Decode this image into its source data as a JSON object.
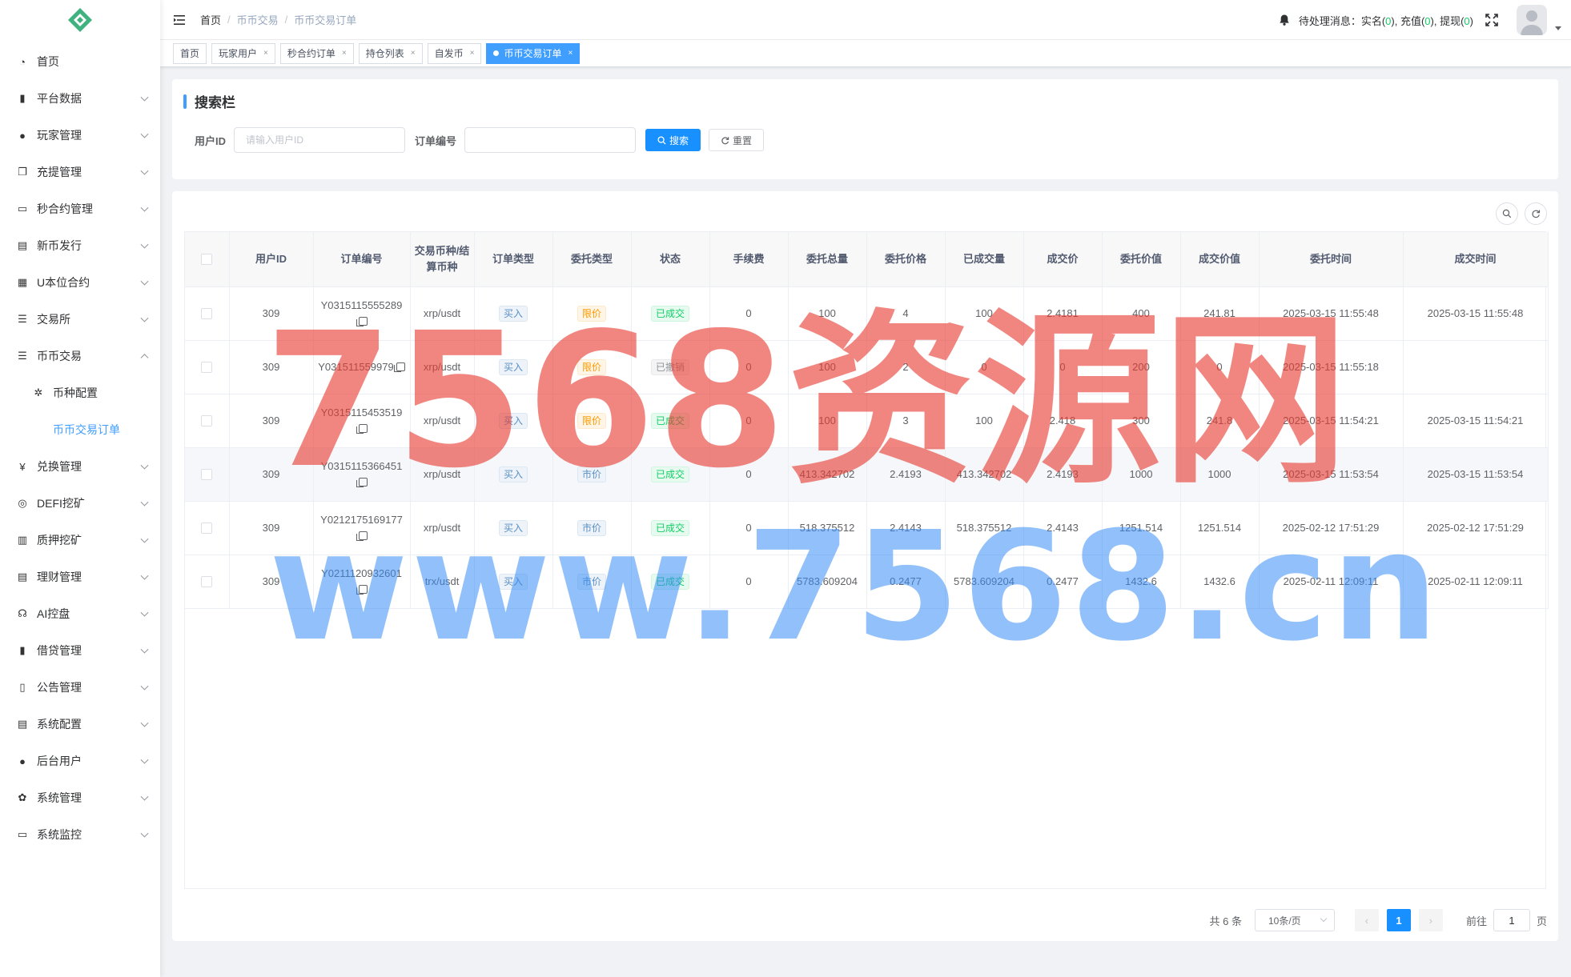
{
  "sidebar": {
    "items": [
      {
        "label": "首页",
        "icon": "dashboard-icon",
        "expand": false
      },
      {
        "label": "平台数据",
        "icon": "book-icon",
        "expand": true
      },
      {
        "label": "玩家管理",
        "icon": "user-icon",
        "expand": true
      },
      {
        "label": "充提管理",
        "icon": "copy-icon",
        "expand": true
      },
      {
        "label": "秒合约管理",
        "icon": "monitor-icon",
        "expand": true
      },
      {
        "label": "新币发行",
        "icon": "form-icon",
        "expand": true
      },
      {
        "label": "U本位合约",
        "icon": "table-icon",
        "expand": true
      },
      {
        "label": "交易所",
        "icon": "list-icon",
        "expand": true
      },
      {
        "label": "币币交易",
        "icon": "list-icon",
        "expand": true,
        "open": true
      },
      {
        "label": "币种配置",
        "icon": "gear-circle-icon",
        "sub": true
      },
      {
        "label": "币币交易订单",
        "icon": "",
        "sub": true,
        "active": true
      },
      {
        "label": "兑换管理",
        "icon": "yen-icon",
        "expand": true
      },
      {
        "label": "DEFI挖矿",
        "icon": "coin-stack-icon",
        "expand": true
      },
      {
        "label": "质押挖矿",
        "icon": "bar-chart-icon",
        "expand": true
      },
      {
        "label": "理财管理",
        "icon": "document-icon",
        "expand": true
      },
      {
        "label": "AI控盘",
        "icon": "robot-icon",
        "expand": true
      },
      {
        "label": "借贷管理",
        "icon": "book-icon",
        "expand": true
      },
      {
        "label": "公告管理",
        "icon": "open-book-icon",
        "expand": true
      },
      {
        "label": "系统配置",
        "icon": "document-icon",
        "expand": true
      },
      {
        "label": "后台用户",
        "icon": "peoples-icon",
        "expand": true
      },
      {
        "label": "系统管理",
        "icon": "gear-icon",
        "expand": true
      },
      {
        "label": "系统监控",
        "icon": "monitor-icon",
        "expand": true
      }
    ]
  },
  "header": {
    "breadcrumb": [
      "首页",
      "币币交易",
      "币币交易订单"
    ],
    "notice": {
      "prefix": "待处理消息：",
      "realname_label": "实名(",
      "realname_count": "0",
      "recharge_label": "), 充值(",
      "recharge_count": "0",
      "withdraw_label": "), 提现(",
      "withdraw_count": "0",
      "suffix": ")"
    }
  },
  "tags": [
    {
      "label": "首页",
      "closable": false,
      "active": false
    },
    {
      "label": "玩家用户",
      "closable": true,
      "active": false
    },
    {
      "label": "秒合约订单",
      "closable": true,
      "active": false
    },
    {
      "label": "持仓列表",
      "closable": true,
      "active": false
    },
    {
      "label": "自发币",
      "closable": true,
      "active": false
    },
    {
      "label": "币币交易订单",
      "closable": true,
      "active": true
    }
  ],
  "search": {
    "title": "搜索栏",
    "user_id_label": "用户ID",
    "user_id_placeholder": "请输入用户ID",
    "order_no_label": "订单编号",
    "order_no_value": "",
    "search_button": "搜索",
    "reset_button": "重置"
  },
  "table": {
    "columns": [
      "用户ID",
      "订单编号",
      "交易币种/结算币种",
      "订单类型",
      "委托类型",
      "状态",
      "手续费",
      "委托总量",
      "委托价格",
      "已成交量",
      "成交价",
      "委托价值",
      "成交价值",
      "委托时间",
      "成交时间"
    ],
    "rows": [
      {
        "user_id": "309",
        "order_no": "Y0315115555289",
        "pair": "xrp/usdt",
        "order_type": "买入",
        "entrust_type": "限价",
        "status": "已成交",
        "fee": "0",
        "total": "100",
        "price": "4",
        "filled": "100",
        "deal_price": "2.4181",
        "entrust_value": "400",
        "deal_value": "241.81",
        "entrust_time": "2025-03-15 11:55:48",
        "deal_time": "2025-03-15 11:55:48"
      },
      {
        "user_id": "309",
        "order_no": "Y031511559979",
        "pair": "xrp/usdt",
        "order_type": "买入",
        "entrust_type": "限价",
        "status": "已撤销",
        "fee": "0",
        "total": "100",
        "price": "2",
        "filled": "0",
        "deal_price": "0",
        "entrust_value": "200",
        "deal_value": "0",
        "entrust_time": "2025-03-15 11:55:18",
        "deal_time": ""
      },
      {
        "user_id": "309",
        "order_no": "Y0315115453519",
        "pair": "xrp/usdt",
        "order_type": "买入",
        "entrust_type": "限价",
        "status": "已成交",
        "fee": "0",
        "total": "100",
        "price": "3",
        "filled": "100",
        "deal_price": "2.418",
        "entrust_value": "300",
        "deal_value": "241.8",
        "entrust_time": "2025-03-15 11:54:21",
        "deal_time": "2025-03-15 11:54:21"
      },
      {
        "user_id": "309",
        "order_no": "Y0315115366451",
        "pair": "xrp/usdt",
        "order_type": "买入",
        "entrust_type": "市价",
        "status": "已成交",
        "fee": "0",
        "total": "413.342702",
        "price": "2.4193",
        "filled": "413.342702",
        "deal_price": "2.4193",
        "entrust_value": "1000",
        "deal_value": "1000",
        "entrust_time": "2025-03-15 11:53:54",
        "deal_time": "2025-03-15 11:53:54"
      },
      {
        "user_id": "309",
        "order_no": "Y0212175169177",
        "pair": "xrp/usdt",
        "order_type": "买入",
        "entrust_type": "市价",
        "status": "已成交",
        "fee": "0",
        "total": "518.375512",
        "price": "2.4143",
        "filled": "518.375512",
        "deal_price": "2.4143",
        "entrust_value": "1251.514",
        "deal_value": "1251.514",
        "entrust_time": "2025-02-12 17:51:29",
        "deal_time": "2025-02-12 17:51:29"
      },
      {
        "user_id": "309",
        "order_no": "Y0211120932601",
        "pair": "trx/usdt",
        "order_type": "买入",
        "entrust_type": "市价",
        "status": "已成交",
        "fee": "0",
        "total": "5783.609204",
        "price": "0.2477",
        "filled": "5783.609204",
        "deal_price": "0.2477",
        "entrust_value": "1432.6",
        "deal_value": "1432.6",
        "entrust_time": "2025-02-11 12:09:11",
        "deal_time": "2025-02-11 12:09:11"
      }
    ]
  },
  "pagination": {
    "total_text": "共 6 条",
    "page_size": "10条/页",
    "current_page": "1",
    "goto_prefix": "前往",
    "goto_value": "1",
    "goto_suffix": "页"
  },
  "watermark": {
    "line1": "7568资源网",
    "line2": "www.7568.cn"
  },
  "colors": {
    "primary": "#1890ff",
    "success": "#13ce66",
    "warning": "#ff9900",
    "watermark_red": "#e83c32",
    "watermark_blue": "#378cf5"
  }
}
